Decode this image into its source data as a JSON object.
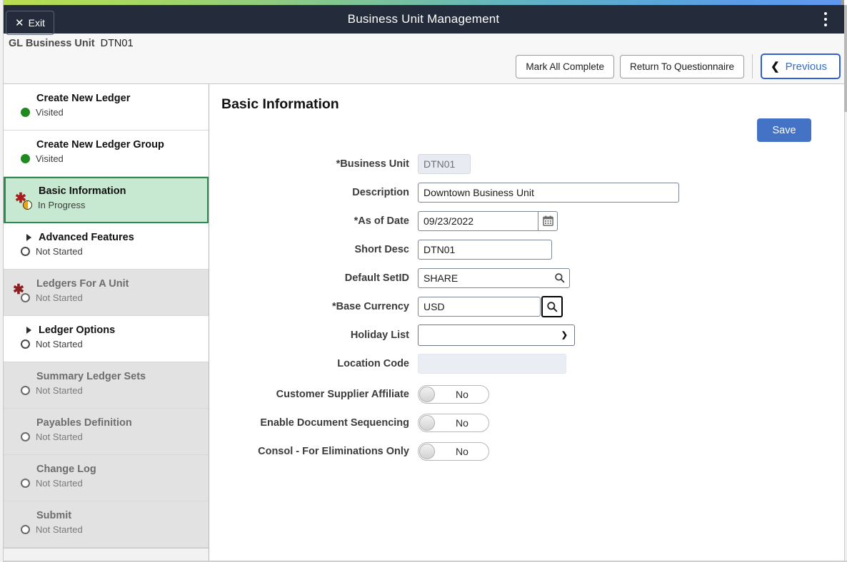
{
  "header": {
    "exit_label": "Exit",
    "exit_icon": "close-x-icon",
    "title": "Business Unit Management",
    "menu_icon": "kebab-menu-icon",
    "progress_start_color": "#b9dd4e",
    "progress_end_color": "#5f98f0",
    "background_color": "#242b3a"
  },
  "subheader": {
    "crumb_label": "GL Business Unit",
    "crumb_value": "DTN01",
    "buttons": [
      {
        "label": "Mark All Complete",
        "name": "mark-all-complete-button"
      },
      {
        "label": "Return To Questionnaire",
        "name": "return-to-questionnaire-button"
      }
    ],
    "previous_label": "Previous",
    "previous_icon": "chevron-left-icon",
    "previous_accent_color": "#2f5fd0"
  },
  "sidebar": {
    "items": [
      {
        "label": "Create New Ledger",
        "status": "Visited",
        "status_icon": "filled-circle-icon",
        "state": "visited",
        "required": false,
        "expandable": false,
        "disabled": false,
        "active": false
      },
      {
        "label": "Create New Ledger Group",
        "status": "Visited",
        "status_icon": "filled-circle-icon",
        "state": "visited",
        "required": false,
        "expandable": false,
        "disabled": false,
        "active": false
      },
      {
        "label": "Basic Information",
        "status": "In Progress",
        "status_icon": "half-filled-circle-icon",
        "state": "inprogress",
        "required": true,
        "expandable": false,
        "disabled": false,
        "active": true
      },
      {
        "label": "Advanced Features",
        "status": "Not Started",
        "status_icon": "hollow-circle-icon",
        "state": "notstarted",
        "required": false,
        "expandable": true,
        "disabled": false,
        "active": false
      },
      {
        "label": "Ledgers For A Unit",
        "status": "Not Started",
        "status_icon": "hollow-circle-icon",
        "state": "notstarted",
        "required": true,
        "expandable": false,
        "disabled": true,
        "active": false
      },
      {
        "label": "Ledger Options",
        "status": "Not Started",
        "status_icon": "hollow-circle-icon",
        "state": "notstarted",
        "required": false,
        "expandable": true,
        "disabled": false,
        "active": false
      },
      {
        "label": "Summary Ledger Sets",
        "status": "Not Started",
        "status_icon": "hollow-circle-icon",
        "state": "notstarted",
        "required": false,
        "expandable": false,
        "disabled": true,
        "active": false
      },
      {
        "label": "Payables Definition",
        "status": "Not Started",
        "status_icon": "hollow-circle-icon",
        "state": "notstarted",
        "required": false,
        "expandable": false,
        "disabled": true,
        "active": false
      },
      {
        "label": "Change Log",
        "status": "Not Started",
        "status_icon": "hollow-circle-icon",
        "state": "notstarted",
        "required": false,
        "expandable": false,
        "disabled": true,
        "active": false
      },
      {
        "label": "Submit",
        "status": "Not Started",
        "status_icon": "hollow-circle-icon",
        "state": "notstarted",
        "required": false,
        "expandable": false,
        "disabled": true,
        "active": false
      }
    ],
    "active_background_color": "#c7e8d1",
    "active_border_color": "#2e8b50",
    "visited_dot_color": "#1f8a1f",
    "inprogress_dot_color": "#e8a317",
    "required_marker_color": "#a81c1c"
  },
  "main": {
    "page_title": "Basic Information",
    "save_label": "Save",
    "save_color": "#4472c4",
    "fields": {
      "business_unit": {
        "label": "*Business Unit",
        "value": "DTN01",
        "disabled": true
      },
      "description": {
        "label": "Description",
        "value": "Downtown Business Unit",
        "disabled": false
      },
      "as_of_date": {
        "label": "*As of Date",
        "value": "09/23/2022",
        "calendar_icon": "calendar-icon",
        "disabled": false
      },
      "short_desc": {
        "label": "Short Desc",
        "value": "DTN01",
        "disabled": false
      },
      "default_setid": {
        "label": "Default SetID",
        "value": "SHARE",
        "lookup_icon": "search-lookup-icon",
        "disabled": false
      },
      "base_currency": {
        "label": "*Base Currency",
        "value": "USD",
        "lookup_icon": "search-lookup-icon",
        "lookup_focused": true,
        "disabled": false
      },
      "holiday_list": {
        "label": "Holiday List",
        "value": "",
        "options": [
          ""
        ],
        "chevron_icon": "chevron-down-icon",
        "disabled": false
      },
      "location_code": {
        "label": "Location Code",
        "value": "",
        "disabled": true
      }
    },
    "toggles": [
      {
        "label": "Customer Supplier Affiliate",
        "value": "No",
        "name": "customer-supplier-affiliate-toggle"
      },
      {
        "label": "Enable Document Sequencing",
        "value": "No",
        "name": "enable-document-sequencing-toggle"
      },
      {
        "label": "Consol - For Eliminations Only",
        "value": "No",
        "name": "consol-for-eliminations-only-toggle"
      }
    ]
  }
}
